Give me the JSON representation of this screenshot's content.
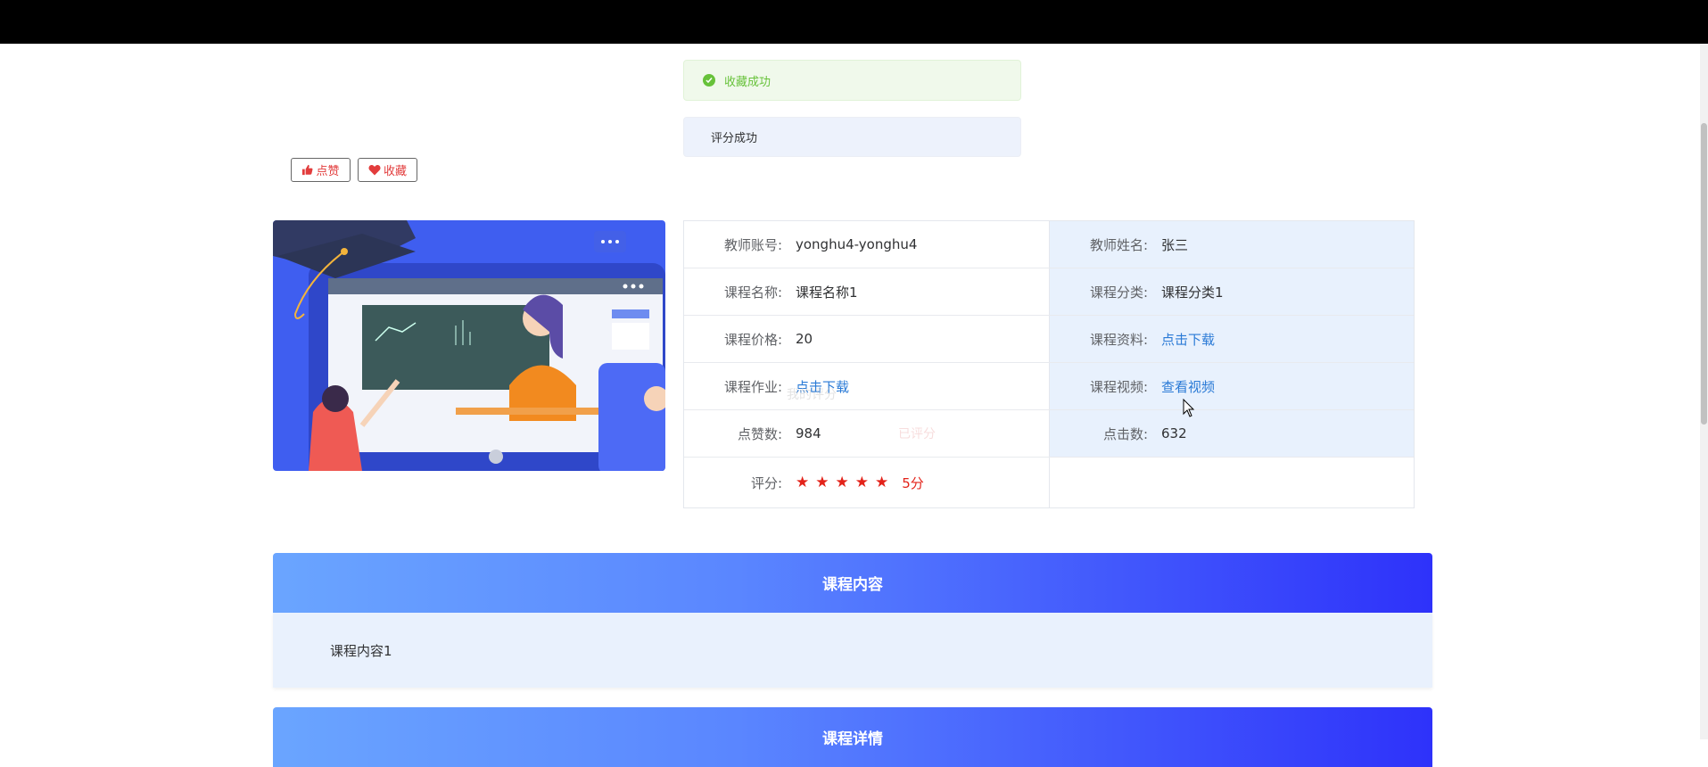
{
  "messages": {
    "success": "收藏成功",
    "info": "评分成功"
  },
  "actions": {
    "like_label": "点赞",
    "favorite_label": "收藏"
  },
  "info": {
    "teacher_account_label": "教师账号:",
    "teacher_account": "yonghu4-yonghu4",
    "teacher_name_label": "教师姓名:",
    "teacher_name": "张三",
    "course_name_label": "课程名称:",
    "course_name": "课程名称1",
    "course_category_label": "课程分类:",
    "course_category": "课程分类1",
    "course_price_label": "课程价格:",
    "course_price": "20",
    "course_material_label": "课程资料:",
    "course_material_link": "点击下载",
    "course_homework_label": "课程作业:",
    "course_homework_link": "点击下载",
    "course_video_label": "课程视频:",
    "course_video_link": "查看视频",
    "likes_label": "点赞数:",
    "likes": "984",
    "clicks_label": "点击数:",
    "clicks": "632",
    "rating_label": "评分:",
    "rating_stars": 5,
    "rating_text": "5分",
    "fading_my_rating": "我的评分",
    "fading_rated": "已评分"
  },
  "sections": {
    "content_title": "课程内容",
    "content_body": "课程内容1",
    "detail_title": "课程详情"
  },
  "colors": {
    "accent": "#e3231a",
    "link": "#2a7ad6",
    "success": "#67c23a",
    "header_gradient_start": "#6aa5ff",
    "header_gradient_end": "#2e32fa"
  }
}
